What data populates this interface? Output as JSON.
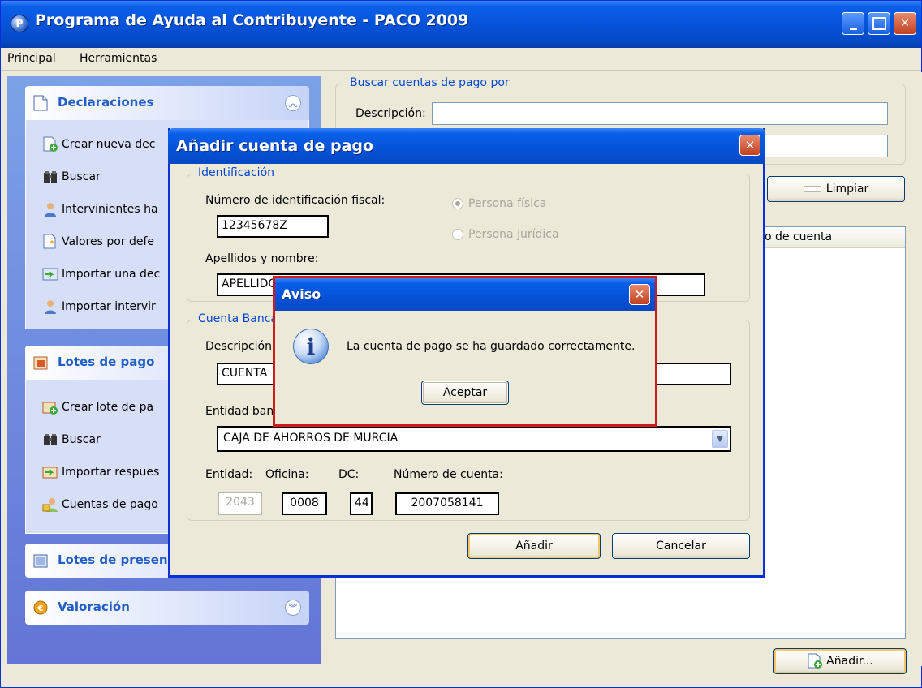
{
  "window": {
    "title": "Programa de Ayuda al Contribuyente - PACO 2009",
    "app_icon_glyph": "P"
  },
  "menu": [
    "Principal",
    "Herramientas"
  ],
  "sidebar": {
    "declaraciones": {
      "title": "Declaraciones",
      "items": [
        "Crear nueva dec",
        "Buscar",
        "Intervinientes ha",
        "Valores por defe",
        "Importar una dec",
        "Importar intervir"
      ]
    },
    "lotes_pago": {
      "title": "Lotes de pago",
      "items": [
        "Crear lote de pa",
        "Buscar",
        "Importar respues",
        "Cuentas de pago"
      ]
    },
    "lotes_presentacion": {
      "title": "Lotes de presen"
    },
    "valoracion": {
      "title": "Valoración"
    }
  },
  "search": {
    "group_title": "Buscar cuentas de pago por",
    "descripcion_label": "Descripción:",
    "descripcion_value": "",
    "second_value": "",
    "limpiar_label": "Limpiar"
  },
  "list": {
    "columns": [
      "o de cuenta"
    ]
  },
  "add_button_label": "Añadir...",
  "dialog": {
    "title": "Añadir cuenta de pago",
    "identificacion": {
      "group_title": "Identificación",
      "nif_label": "Número de identificación fiscal:",
      "nif_value": "12345678Z",
      "persona_fisica": "Persona física",
      "persona_juridica": "Persona jurídica",
      "selected": "Persona física",
      "apellidos_label": "Apellidos y nombre:",
      "apellidos_value": "APELLIDO"
    },
    "cuenta": {
      "group_title": "Cuenta Banca",
      "descripcion_label": "Descripción:",
      "descripcion_value": "CUENTA",
      "entidad_label": "Entidad ban",
      "entidad_value": "CAJA DE AHORROS DE MURCIA",
      "entidad_short_label": "Entidad:",
      "oficina_label": "Oficina:",
      "dc_label": "DC:",
      "numero_label": "Número de cuenta:",
      "entidad_code": "2043",
      "oficina_code": "0008",
      "dc_code": "44",
      "numero_code": "2007058141"
    },
    "add_label": "Añadir",
    "cancel_label": "Cancelar"
  },
  "message": {
    "title": "Aviso",
    "text": "La cuenta de pago se ha guardado correctamente.",
    "ok_label": "Aceptar",
    "icon_glyph": "i"
  },
  "colors": {
    "title_blue": "#0653d9",
    "section_title": "#215dc6",
    "group_title": "#0046d5",
    "alert_border": "#d21a1a"
  }
}
